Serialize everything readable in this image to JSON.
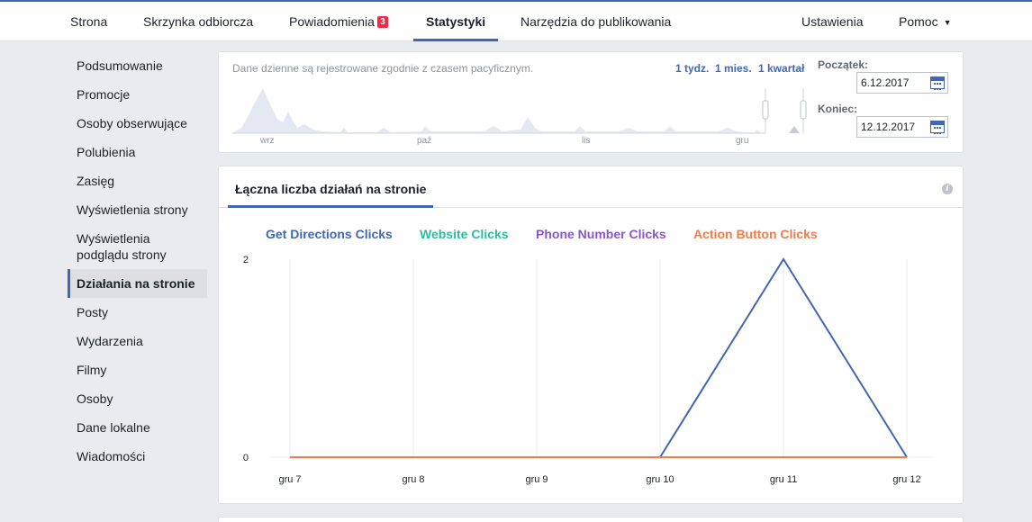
{
  "nav": {
    "tabs": [
      {
        "label": "Strona"
      },
      {
        "label": "Skrzynka odbiorcza"
      },
      {
        "label": "Powiadomienia",
        "badge": "3"
      },
      {
        "label": "Statystyki",
        "active": true
      },
      {
        "label": "Narzędzia do publikowania"
      }
    ],
    "settings_label": "Ustawienia",
    "help_label": "Pomoc"
  },
  "sidebar": {
    "items": [
      {
        "label": "Podsumowanie"
      },
      {
        "label": "Promocje"
      },
      {
        "label": "Osoby obserwujące"
      },
      {
        "label": "Polubienia"
      },
      {
        "label": "Zasięg"
      },
      {
        "label": "Wyświetlenia strony"
      },
      {
        "label": "Wyświetlenia podglądu strony"
      },
      {
        "label": "Działania na stronie",
        "active": true
      },
      {
        "label": "Posty"
      },
      {
        "label": "Wydarzenia"
      },
      {
        "label": "Filmy"
      },
      {
        "label": "Osoby"
      },
      {
        "label": "Dane lokalne"
      },
      {
        "label": "Wiadomości"
      }
    ]
  },
  "date_panel": {
    "note": "Dane dzienne są rejestrowane zgodnie z czasem pacyficznym.",
    "ranges": [
      "1 tydz.",
      "1 mies.",
      "1 kwartał"
    ],
    "timeline_months": [
      "wrz",
      "paź",
      "lis",
      "gru"
    ],
    "start_label": "Początek:",
    "start_value": "6.12.2017",
    "end_label": "Koniec:",
    "end_value": "12.12.2017"
  },
  "chart_panel": {
    "tab_label": "Łączna liczba działań na stronie",
    "info_icon": "info-icon"
  },
  "colors": {
    "accent": "#4267b2",
    "get_directions": "#4267b2",
    "website": "#2bbd9b",
    "phone": "#8a56c9",
    "action_button": "#f07c4b"
  },
  "chart_data": {
    "type": "line",
    "x": [
      "gru 7",
      "gru 8",
      "gru 9",
      "gru 10",
      "gru 11",
      "gru 12"
    ],
    "ytick_labels": [
      "0",
      "2"
    ],
    "ylim": [
      0,
      2
    ],
    "grid": true,
    "legend_position": "top",
    "series": [
      {
        "name": "Get Directions Clicks",
        "color": "#4267b2",
        "values": [
          0,
          0,
          0,
          0,
          2,
          0
        ]
      },
      {
        "name": "Website Clicks",
        "color": "#2bbd9b",
        "values": [
          0,
          0,
          0,
          0,
          0,
          0
        ]
      },
      {
        "name": "Phone Number Clicks",
        "color": "#8a56c9",
        "values": [
          0,
          0,
          0,
          0,
          0,
          0
        ]
      },
      {
        "name": "Action Button Clicks",
        "color": "#f07c4b",
        "values": [
          0,
          0,
          0,
          0,
          0,
          0
        ]
      }
    ]
  }
}
